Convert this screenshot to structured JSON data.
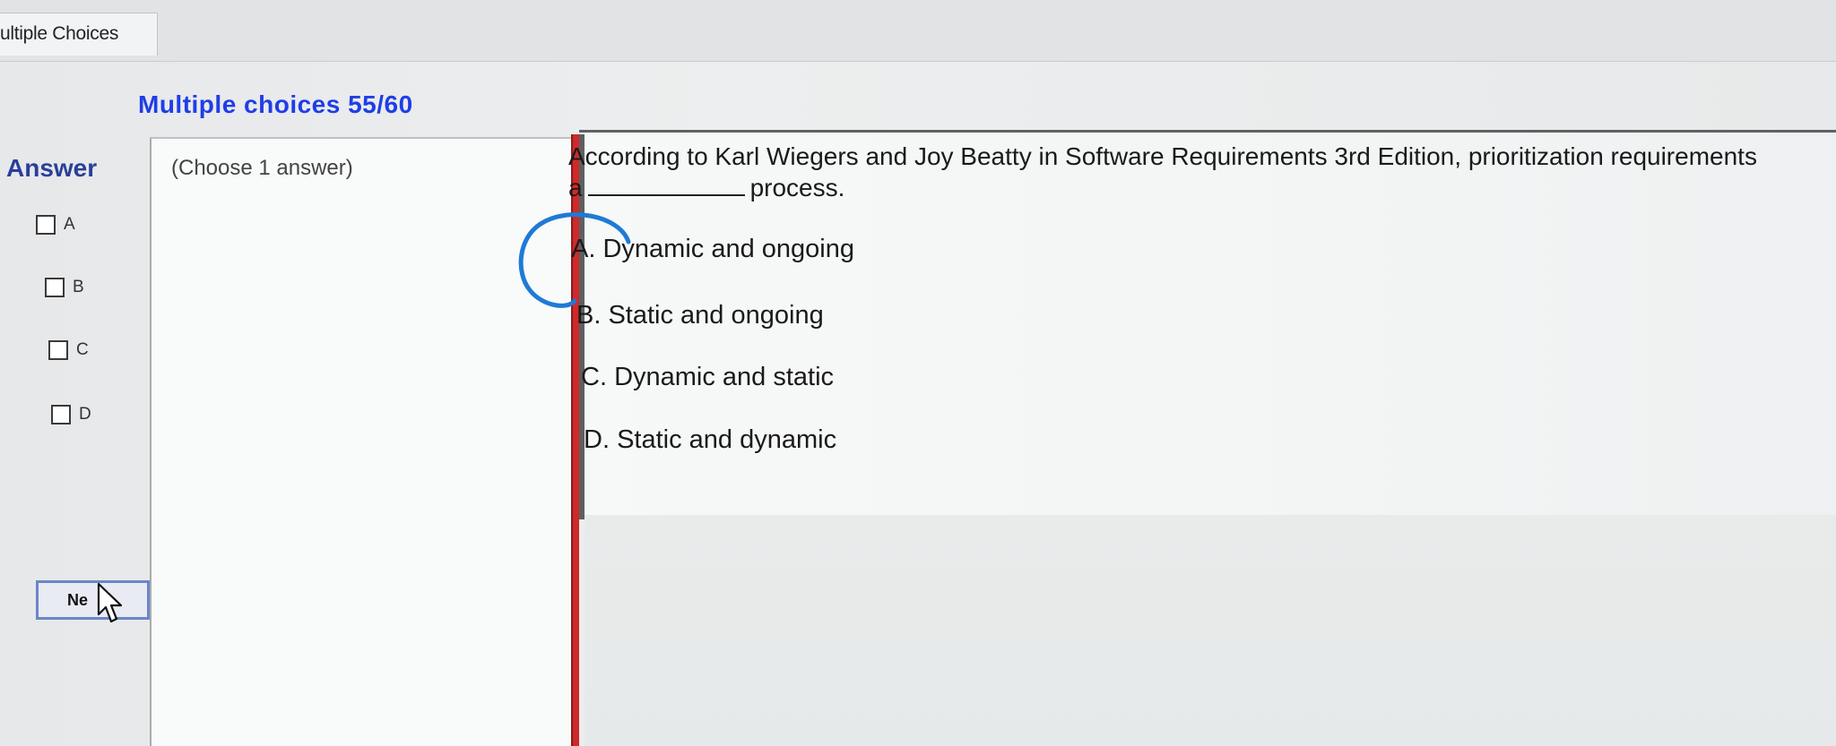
{
  "tab": {
    "label": "ultiple Choices"
  },
  "header": {
    "title": "Multiple choices 55/60"
  },
  "answer_panel": {
    "label": "Answer",
    "options": [
      "A",
      "B",
      "C",
      "D"
    ],
    "next_button": "Ne"
  },
  "instructions": {
    "text": "(Choose 1 answer)"
  },
  "question": {
    "line1": "According to Karl Wiegers and Joy Beatty in Software Requirements 3rd Edition, prioritization requirements",
    "line2_prefix": "a",
    "line2_suffix": "process.",
    "choices": [
      {
        "letter": "A.",
        "text": "Dynamic and ongoing"
      },
      {
        "letter": "B.",
        "text": "Static and ongoing"
      },
      {
        "letter": "C.",
        "text": "Dynamic and static"
      },
      {
        "letter": "D.",
        "text": "Static and dynamic"
      }
    ]
  },
  "colors": {
    "title_blue": "#1f3ee6",
    "answer_label": "#2a3f9a",
    "divider_red": "#cf2a2a",
    "annotation_circle": "#1f7ad6"
  },
  "icons": [
    "checkbox-icon",
    "mouse-cursor-icon",
    "hand-drawn-circle-annotation"
  ]
}
